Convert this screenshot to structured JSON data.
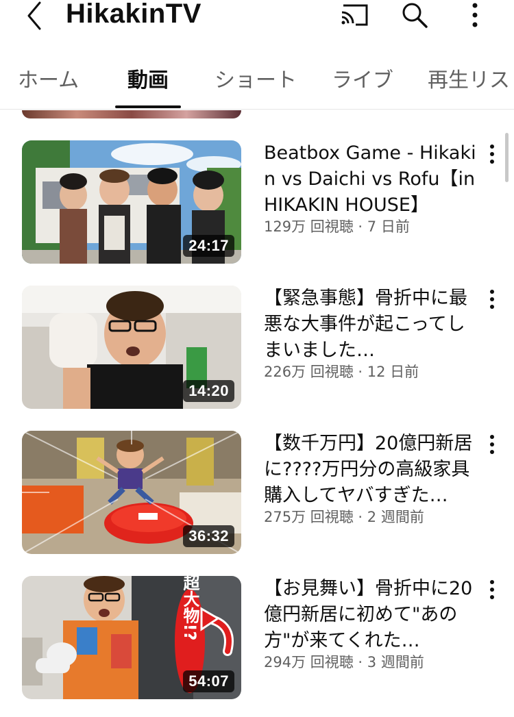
{
  "header": {
    "title": "HikakinTV",
    "back_icon": "back-arrow-icon",
    "cast_icon": "cast-icon",
    "search_icon": "search-icon",
    "more_icon": "more-vert-icon"
  },
  "tabs": [
    {
      "label": "ホーム",
      "active": false
    },
    {
      "label": "動画",
      "active": true
    },
    {
      "label": "ショート",
      "active": false
    },
    {
      "label": "ライブ",
      "active": false
    },
    {
      "label": "再生リス",
      "active": false
    }
  ],
  "videos": [
    {
      "title": "Beatbox Game - Hikakin vs Daichi vs Rofu【in HIKAKIN HOUSE】",
      "meta": "129万 回視聴 · 7 日前",
      "duration": "24:17"
    },
    {
      "title": "【緊急事態】骨折中に最悪な大事件が起こってしまいました…",
      "meta": "226万 回視聴 · 12 日前",
      "duration": "14:20"
    },
    {
      "title": "【数千万円】20億円新居に????万円分の高級家具購入してヤバすぎた…",
      "meta": "275万 回視聴 · 2 週間前",
      "duration": "36:32"
    },
    {
      "title": "【お見舞い】骨折中に20億円新居に初めて\"あの方\"が来てくれた…",
      "meta": "294万 回視聴 · 3 週間前",
      "duration": "54:07",
      "thumb_text": "超大物!?"
    }
  ],
  "colors": {
    "text_primary": "#0f0f0f",
    "text_secondary": "#606060",
    "divider": "#e5e5e5",
    "duration_bg": "rgba(0,0,0,0.72)"
  }
}
